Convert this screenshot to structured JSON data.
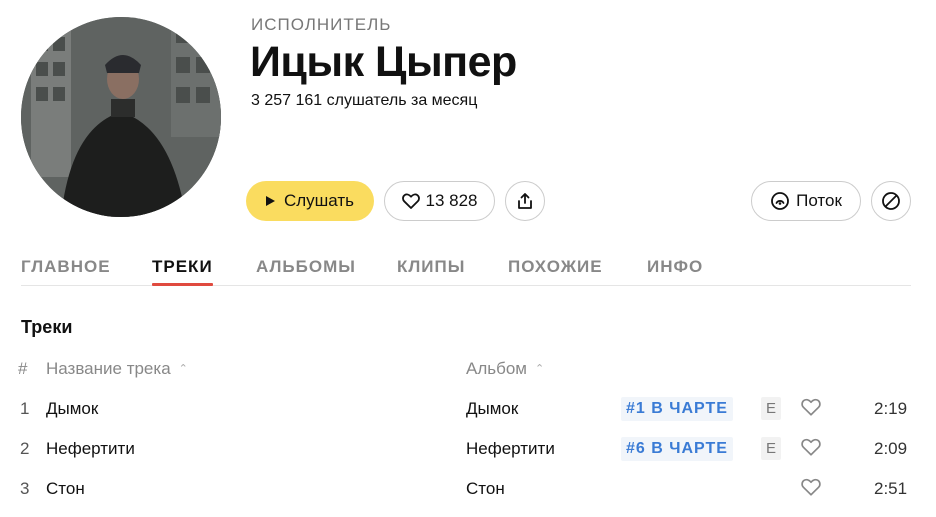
{
  "artist": {
    "type_label": "ИСПОЛНИТЕЛЬ",
    "name": "Ицык Цыпер",
    "listeners": "3 257 161 слушатель за месяц"
  },
  "actions": {
    "play_label": "Слушать",
    "likes_count": "13 828",
    "flow_label": "Поток"
  },
  "tabs": [
    {
      "label": "ГЛАВНОЕ",
      "active": false
    },
    {
      "label": "ТРЕКИ",
      "active": true
    },
    {
      "label": "АЛЬБОМЫ",
      "active": false
    },
    {
      "label": "КЛИПЫ",
      "active": false
    },
    {
      "label": "ПОХОЖИЕ",
      "active": false
    },
    {
      "label": "ИНФО",
      "active": false
    }
  ],
  "tracks_section": {
    "title": "Треки",
    "headers": {
      "num": "#",
      "title": "Название трека",
      "album": "Альбом"
    },
    "rows": [
      {
        "num": "1",
        "title": "Дымок",
        "album": "Дымок",
        "chart": "#1 В ЧАРТЕ",
        "explicit": "E",
        "duration": "2:19"
      },
      {
        "num": "2",
        "title": "Нефертити",
        "album": "Нефертити",
        "chart": "#6 В ЧАРТЕ",
        "explicit": "E",
        "duration": "2:09"
      },
      {
        "num": "3",
        "title": "Стон",
        "album": "Стон",
        "chart": "",
        "explicit": "",
        "duration": "2:51"
      }
    ]
  },
  "colors": {
    "accent_yellow": "#fadc5f",
    "active_tab_underline": "#e04a3f",
    "chart_badge_text": "#3a7bd5"
  },
  "icons": [
    "play-icon",
    "heart-icon",
    "share-icon",
    "flow-icon",
    "block-icon",
    "sort-arrow-icon"
  ]
}
